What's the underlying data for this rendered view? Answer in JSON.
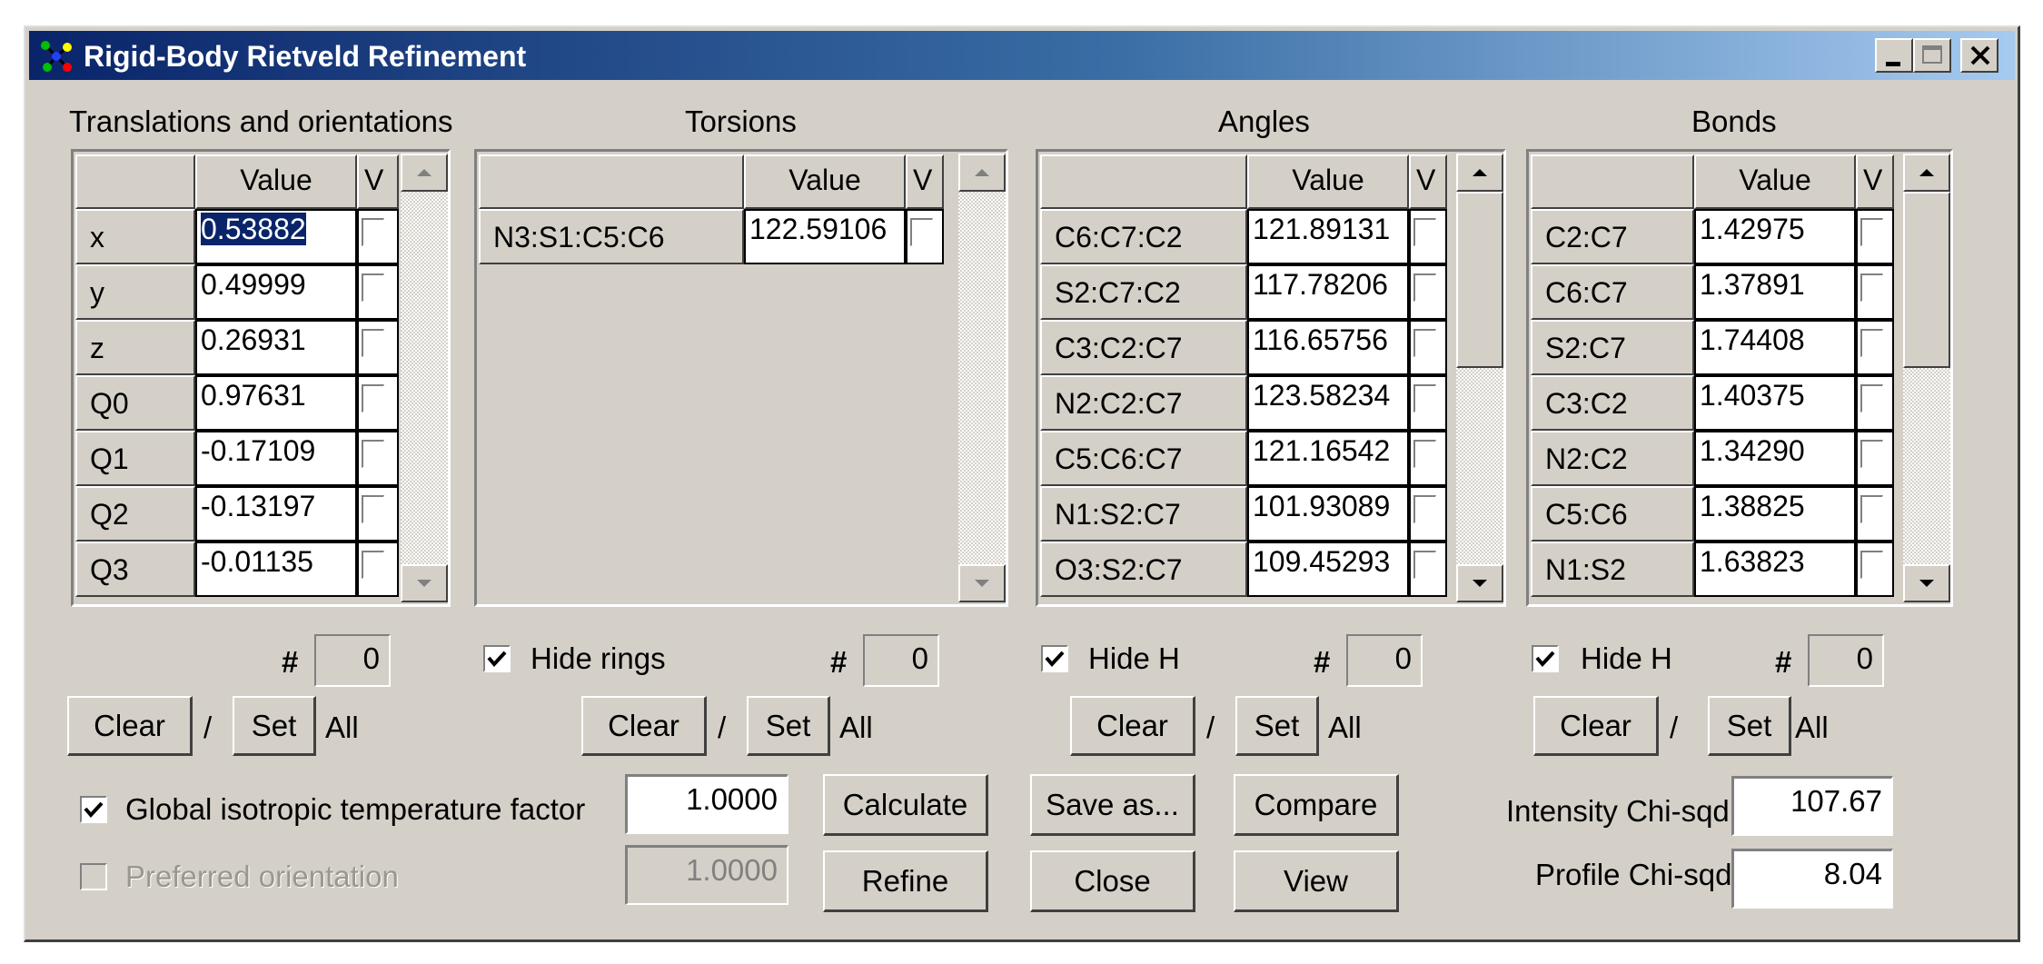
{
  "window": {
    "title": "Rigid-Body Rietveld Refinement",
    "caption_buttons": [
      "minimize-icon",
      "maximize-icon",
      "close-icon"
    ]
  },
  "panels": {
    "translations": {
      "title": "Translations and orientations",
      "col_value": "Value",
      "col_v": "V",
      "rows": [
        {
          "label": "x",
          "value": "0.53882",
          "selected": true
        },
        {
          "label": "y",
          "value": "0.49999"
        },
        {
          "label": "z",
          "value": "0.26931"
        },
        {
          "label": "Q0",
          "value": "0.97631"
        },
        {
          "label": "Q1",
          "value": "-0.17109"
        },
        {
          "label": "Q2",
          "value": "-0.13197"
        },
        {
          "label": "Q3",
          "value": "-0.01135"
        }
      ],
      "hash": "#",
      "count": "0",
      "clear": "Clear",
      "slash": "/",
      "set": "Set",
      "all": "All"
    },
    "torsions": {
      "title": "Torsions",
      "col_value": "Value",
      "col_v": "V",
      "rows": [
        {
          "label": "N3:S1:C5:C6",
          "value": "122.59106"
        }
      ],
      "hide_label": "Hide rings",
      "hide_checked": true,
      "hash": "#",
      "count": "0",
      "clear": "Clear",
      "slash": "/",
      "set": "Set",
      "all": "All"
    },
    "angles": {
      "title": "Angles",
      "col_value": "Value",
      "col_v": "V",
      "rows": [
        {
          "label": "C6:C7:C2",
          "value": "121.89131"
        },
        {
          "label": "S2:C7:C2",
          "value": "117.78206"
        },
        {
          "label": "C3:C2:C7",
          "value": "116.65756"
        },
        {
          "label": "N2:C2:C7",
          "value": "123.58234"
        },
        {
          "label": "C5:C6:C7",
          "value": "121.16542"
        },
        {
          "label": "N1:S2:C7",
          "value": "101.93089"
        },
        {
          "label": "O3:S2:C7",
          "value": "109.45293"
        }
      ],
      "hide_label": "Hide H",
      "hide_checked": true,
      "hash": "#",
      "count": "0",
      "clear": "Clear",
      "slash": "/",
      "set": "Set",
      "all": "All"
    },
    "bonds": {
      "title": "Bonds",
      "col_value": "Value",
      "col_v": "V",
      "rows": [
        {
          "label": "C2:C7",
          "value": "1.42975"
        },
        {
          "label": "C6:C7",
          "value": "1.37891"
        },
        {
          "label": "S2:C7",
          "value": "1.74408"
        },
        {
          "label": "C3:C2",
          "value": "1.40375"
        },
        {
          "label": "N2:C2",
          "value": "1.34290"
        },
        {
          "label": "C5:C6",
          "value": "1.38825"
        },
        {
          "label": "N1:S2",
          "value": "1.63823"
        }
      ],
      "hide_label": "Hide H",
      "hide_checked": true,
      "hash": "#",
      "count": "0",
      "clear": "Clear",
      "slash": "/",
      "set": "Set",
      "all": "All"
    }
  },
  "bottom": {
    "global_temp": {
      "label": "Global isotropic temperature factor",
      "checked": true,
      "value": "1.0000"
    },
    "preferred_orientation": {
      "label": "Preferred orientation",
      "checked": false,
      "enabled": false,
      "value": "1.0000"
    },
    "buttons": {
      "calculate": "Calculate",
      "refine": "Refine",
      "save_as": "Save as...",
      "close": "Close",
      "compare": "Compare",
      "view": "View"
    },
    "intensity_chi": {
      "label": "Intensity Chi-sqd",
      "value": "107.67"
    },
    "profile_chi": {
      "label": "Profile Chi-sqd",
      "value": "8.04"
    }
  }
}
